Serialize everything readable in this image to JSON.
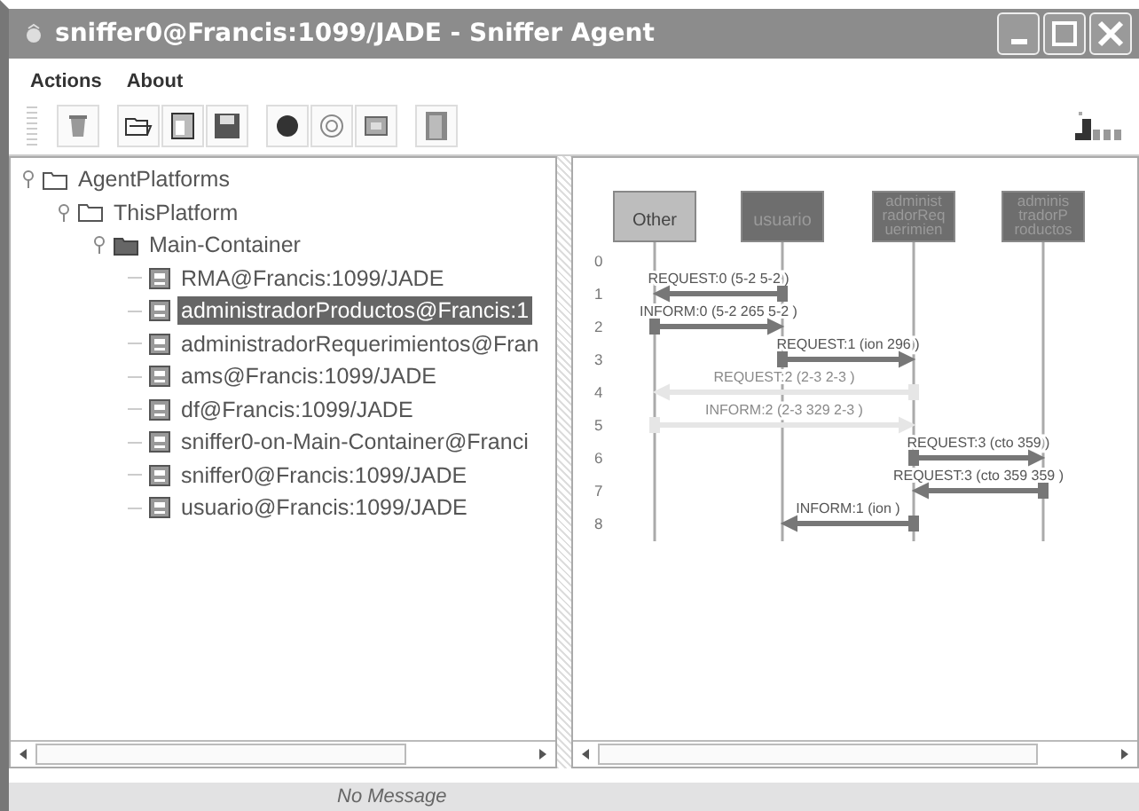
{
  "window": {
    "title": "sniffer0@Francis:1099/JADE - Sniffer Agent"
  },
  "menu": [
    "Actions",
    "About"
  ],
  "tree": [
    {
      "label": "AgentPlatforms",
      "kind": "folder",
      "expanded": true,
      "children": [
        {
          "label": "ThisPlatform",
          "kind": "folder",
          "expanded": true,
          "children": [
            {
              "label": "Main-Container",
              "kind": "container",
              "expanded": true,
              "children": [
                {
                  "label": "RMA@Francis:1099/JADE",
                  "kind": "agent",
                  "selected": false
                },
                {
                  "label": "administradorProductos@Francis:1",
                  "kind": "agent",
                  "selected": true
                },
                {
                  "label": "administradorRequerimientos@Fran",
                  "kind": "agent",
                  "selected": false
                },
                {
                  "label": "ams@Francis:1099/JADE",
                  "kind": "agent",
                  "selected": false
                },
                {
                  "label": "df@Francis:1099/JADE",
                  "kind": "agent",
                  "selected": false
                },
                {
                  "label": "sniffer0-on-Main-Container@Franci",
                  "kind": "agent",
                  "selected": false
                },
                {
                  "label": "sniffer0@Francis:1099/JADE",
                  "kind": "agent",
                  "selected": false
                },
                {
                  "label": "usuario@Francis:1099/JADE",
                  "kind": "agent",
                  "selected": false
                }
              ]
            }
          ]
        }
      ]
    }
  ],
  "diagram": {
    "agents": [
      {
        "lines": [
          "Other"
        ],
        "kind": "other"
      },
      {
        "lines": [
          "usuario"
        ],
        "kind": "agent"
      },
      {
        "lines": [
          "administ",
          "radorReq",
          "uerimien"
        ],
        "kind": "agent"
      },
      {
        "lines": [
          "adminis",
          "tradorP",
          "roductos"
        ],
        "kind": "agent"
      }
    ],
    "rows": [
      {
        "number": "0"
      },
      {
        "number": "1",
        "message": {
          "lanes": [
            {
              "sends": false,
              "receives": true
            },
            {
              "sends": true,
              "receives": false
            },
            {
              "sends": false,
              "receives": false
            },
            {
              "sends": false,
              "receives": false
            }
          ],
          "label": "REQUEST:0 (5-2  5-2    )",
          "dimmed": false
        }
      },
      {
        "number": "2",
        "message": {
          "lanes": [
            {
              "sends": true,
              "receives": false
            },
            {
              "sends": false,
              "receives": true
            },
            {
              "sends": false,
              "receives": false
            },
            {
              "sends": false,
              "receives": false
            }
          ],
          "label": "INFORM:0 (5-2  265  5-2 )",
          "dimmed": false
        }
      },
      {
        "number": "3",
        "message": {
          "lanes": [
            {
              "sends": false,
              "receives": false
            },
            {
              "sends": true,
              "receives": false
            },
            {
              "sends": false,
              "receives": true
            },
            {
              "sends": false,
              "receives": false
            }
          ],
          "label": "REQUEST:1 (ion  296    )",
          "dimmed": false
        }
      },
      {
        "number": "4",
        "message": {
          "lanes": [
            {
              "sends": false,
              "receives": true
            },
            {
              "sends": false,
              "receives": false
            },
            {
              "sends": true,
              "receives": false
            },
            {
              "sends": false,
              "receives": false
            }
          ],
          "label": "REQUEST:2 (2-3  2-3    )",
          "dimmed": true
        }
      },
      {
        "number": "5",
        "message": {
          "lanes": [
            {
              "sends": true,
              "receives": false
            },
            {
              "sends": false,
              "receives": false
            },
            {
              "sends": false,
              "receives": true
            },
            {
              "sends": false,
              "receives": false
            }
          ],
          "label": "INFORM:2 (2-3  329  2-3 )",
          "dimmed": true
        }
      },
      {
        "number": "6",
        "message": {
          "lanes": [
            {
              "sends": false,
              "receives": false
            },
            {
              "sends": false,
              "receives": false
            },
            {
              "sends": true,
              "receives": false
            },
            {
              "sends": false,
              "receives": true
            }
          ],
          "label": "REQUEST:3 (cto  359    )",
          "dimmed": false
        }
      },
      {
        "number": "7",
        "message": {
          "lanes": [
            {
              "sends": false,
              "receives": false
            },
            {
              "sends": false,
              "receives": false
            },
            {
              "sends": false,
              "receives": true
            },
            {
              "sends": true,
              "receives": false
            }
          ],
          "label": "REQUEST:3 (cto  359  359 )",
          "dimmed": false
        }
      },
      {
        "number": "8",
        "message": {
          "lanes": [
            {
              "sends": false,
              "receives": false
            },
            {
              "sends": false,
              "receives": true
            },
            {
              "sends": true,
              "receives": false
            },
            {
              "sends": false,
              "receives": false
            }
          ],
          "label": "INFORM:1 (ion      )",
          "dimmed": false
        }
      }
    ]
  },
  "status_bar": "No Message"
}
